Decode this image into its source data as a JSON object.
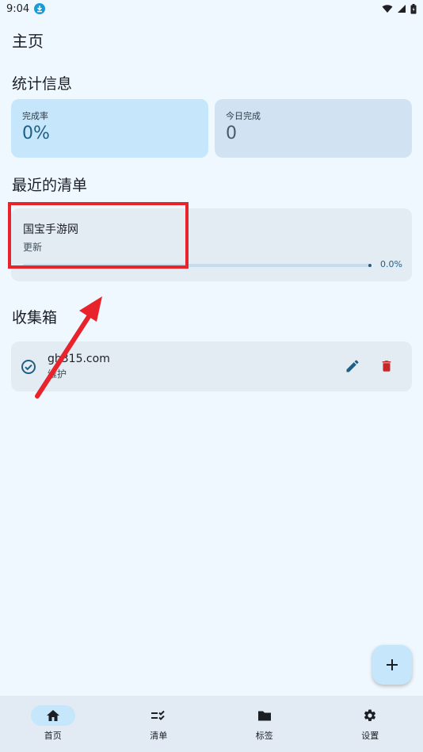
{
  "status_bar": {
    "time": "9:04"
  },
  "page_title": "主页",
  "stats": {
    "section_title": "统计信息",
    "completion_rate_label": "完成率",
    "completion_rate_value": "0%",
    "today_done_label": "今日完成",
    "today_done_value": "0"
  },
  "recent_lists": {
    "section_title": "最近的清单",
    "items": [
      {
        "name": "国宝手游网",
        "subtitle": "更新",
        "progress_text": "0.0%",
        "progress": 0.0
      }
    ]
  },
  "inbox": {
    "section_title": "收集箱",
    "items": [
      {
        "title": "gh315.com",
        "subtitle": "维护"
      }
    ]
  },
  "bottom_nav": {
    "items": [
      {
        "label": "首页",
        "icon": "home-icon",
        "active": true
      },
      {
        "label": "清单",
        "icon": "checklist-icon",
        "active": false
      },
      {
        "label": "标签",
        "icon": "folder-icon",
        "active": false
      },
      {
        "label": "设置",
        "icon": "gear-icon",
        "active": false
      }
    ]
  },
  "colors": {
    "background": "#f0f8ff",
    "accent": "#1f5f85",
    "delete": "#c62828",
    "annotation": "#e8232b"
  }
}
